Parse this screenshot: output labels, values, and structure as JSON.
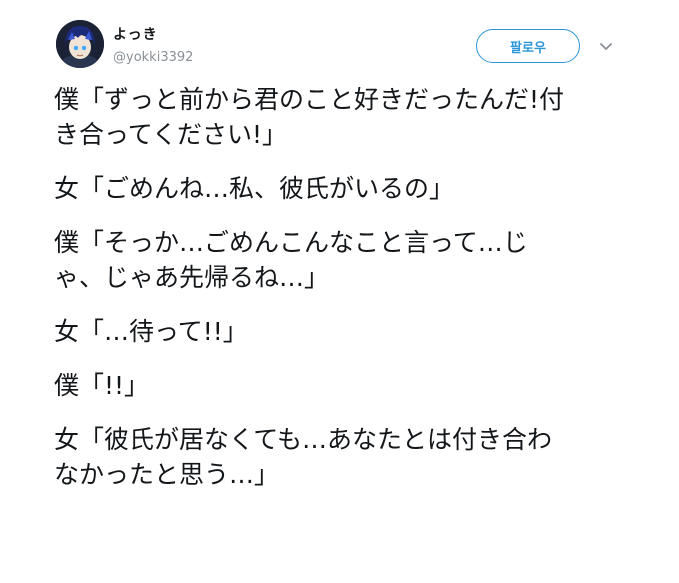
{
  "user": {
    "display_name": "よっき",
    "handle": "@yokki3392",
    "avatar_icon": "user-avatar"
  },
  "actions": {
    "follow_label": "팔로우",
    "more_icon": "chevron-down-icon"
  },
  "colors": {
    "accent": "#2c96d8",
    "text": "#14171a",
    "muted": "#8a9096"
  },
  "tweet": {
    "paragraphs": [
      [
        "僕「ずっと前から君のこと好きだったんだ!付",
        "き合ってください!」"
      ],
      [
        "女「ごめんね…私、彼氏がいるの」"
      ],
      [
        "僕「そっか…ごめんこんなこと言って…じ",
        "ゃ、じゃあ先帰るね…」"
      ],
      [
        "女「…待って!!」"
      ],
      [
        "僕「!!」"
      ],
      [
        "女「彼氏が居なくても…あなたとは付き合わ",
        "なかったと思う…」"
      ]
    ]
  }
}
